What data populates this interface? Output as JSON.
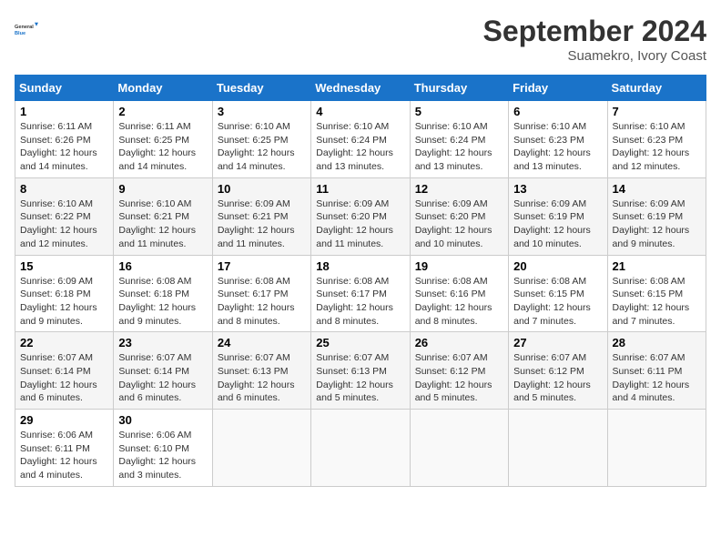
{
  "header": {
    "logo_line1": "General",
    "logo_line2": "Blue",
    "month": "September 2024",
    "location": "Suamekro, Ivory Coast"
  },
  "days_of_week": [
    "Sunday",
    "Monday",
    "Tuesday",
    "Wednesday",
    "Thursday",
    "Friday",
    "Saturday"
  ],
  "weeks": [
    [
      {
        "day": 1,
        "sunrise": "6:11 AM",
        "sunset": "6:26 PM",
        "daylight": "12 hours and 14 minutes."
      },
      {
        "day": 2,
        "sunrise": "6:11 AM",
        "sunset": "6:25 PM",
        "daylight": "12 hours and 14 minutes."
      },
      {
        "day": 3,
        "sunrise": "6:10 AM",
        "sunset": "6:25 PM",
        "daylight": "12 hours and 14 minutes."
      },
      {
        "day": 4,
        "sunrise": "6:10 AM",
        "sunset": "6:24 PM",
        "daylight": "12 hours and 13 minutes."
      },
      {
        "day": 5,
        "sunrise": "6:10 AM",
        "sunset": "6:24 PM",
        "daylight": "12 hours and 13 minutes."
      },
      {
        "day": 6,
        "sunrise": "6:10 AM",
        "sunset": "6:23 PM",
        "daylight": "12 hours and 13 minutes."
      },
      {
        "day": 7,
        "sunrise": "6:10 AM",
        "sunset": "6:23 PM",
        "daylight": "12 hours and 12 minutes."
      }
    ],
    [
      {
        "day": 8,
        "sunrise": "6:10 AM",
        "sunset": "6:22 PM",
        "daylight": "12 hours and 12 minutes."
      },
      {
        "day": 9,
        "sunrise": "6:10 AM",
        "sunset": "6:21 PM",
        "daylight": "12 hours and 11 minutes."
      },
      {
        "day": 10,
        "sunrise": "6:09 AM",
        "sunset": "6:21 PM",
        "daylight": "12 hours and 11 minutes."
      },
      {
        "day": 11,
        "sunrise": "6:09 AM",
        "sunset": "6:20 PM",
        "daylight": "12 hours and 11 minutes."
      },
      {
        "day": 12,
        "sunrise": "6:09 AM",
        "sunset": "6:20 PM",
        "daylight": "12 hours and 10 minutes."
      },
      {
        "day": 13,
        "sunrise": "6:09 AM",
        "sunset": "6:19 PM",
        "daylight": "12 hours and 10 minutes."
      },
      {
        "day": 14,
        "sunrise": "6:09 AM",
        "sunset": "6:19 PM",
        "daylight": "12 hours and 9 minutes."
      }
    ],
    [
      {
        "day": 15,
        "sunrise": "6:09 AM",
        "sunset": "6:18 PM",
        "daylight": "12 hours and 9 minutes."
      },
      {
        "day": 16,
        "sunrise": "6:08 AM",
        "sunset": "6:18 PM",
        "daylight": "12 hours and 9 minutes."
      },
      {
        "day": 17,
        "sunrise": "6:08 AM",
        "sunset": "6:17 PM",
        "daylight": "12 hours and 8 minutes."
      },
      {
        "day": 18,
        "sunrise": "6:08 AM",
        "sunset": "6:17 PM",
        "daylight": "12 hours and 8 minutes."
      },
      {
        "day": 19,
        "sunrise": "6:08 AM",
        "sunset": "6:16 PM",
        "daylight": "12 hours and 8 minutes."
      },
      {
        "day": 20,
        "sunrise": "6:08 AM",
        "sunset": "6:15 PM",
        "daylight": "12 hours and 7 minutes."
      },
      {
        "day": 21,
        "sunrise": "6:08 AM",
        "sunset": "6:15 PM",
        "daylight": "12 hours and 7 minutes."
      }
    ],
    [
      {
        "day": 22,
        "sunrise": "6:07 AM",
        "sunset": "6:14 PM",
        "daylight": "12 hours and 6 minutes."
      },
      {
        "day": 23,
        "sunrise": "6:07 AM",
        "sunset": "6:14 PM",
        "daylight": "12 hours and 6 minutes."
      },
      {
        "day": 24,
        "sunrise": "6:07 AM",
        "sunset": "6:13 PM",
        "daylight": "12 hours and 6 minutes."
      },
      {
        "day": 25,
        "sunrise": "6:07 AM",
        "sunset": "6:13 PM",
        "daylight": "12 hours and 5 minutes."
      },
      {
        "day": 26,
        "sunrise": "6:07 AM",
        "sunset": "6:12 PM",
        "daylight": "12 hours and 5 minutes."
      },
      {
        "day": 27,
        "sunrise": "6:07 AM",
        "sunset": "6:12 PM",
        "daylight": "12 hours and 5 minutes."
      },
      {
        "day": 28,
        "sunrise": "6:07 AM",
        "sunset": "6:11 PM",
        "daylight": "12 hours and 4 minutes."
      }
    ],
    [
      {
        "day": 29,
        "sunrise": "6:06 AM",
        "sunset": "6:11 PM",
        "daylight": "12 hours and 4 minutes."
      },
      {
        "day": 30,
        "sunrise": "6:06 AM",
        "sunset": "6:10 PM",
        "daylight": "12 hours and 3 minutes."
      },
      null,
      null,
      null,
      null,
      null
    ]
  ]
}
